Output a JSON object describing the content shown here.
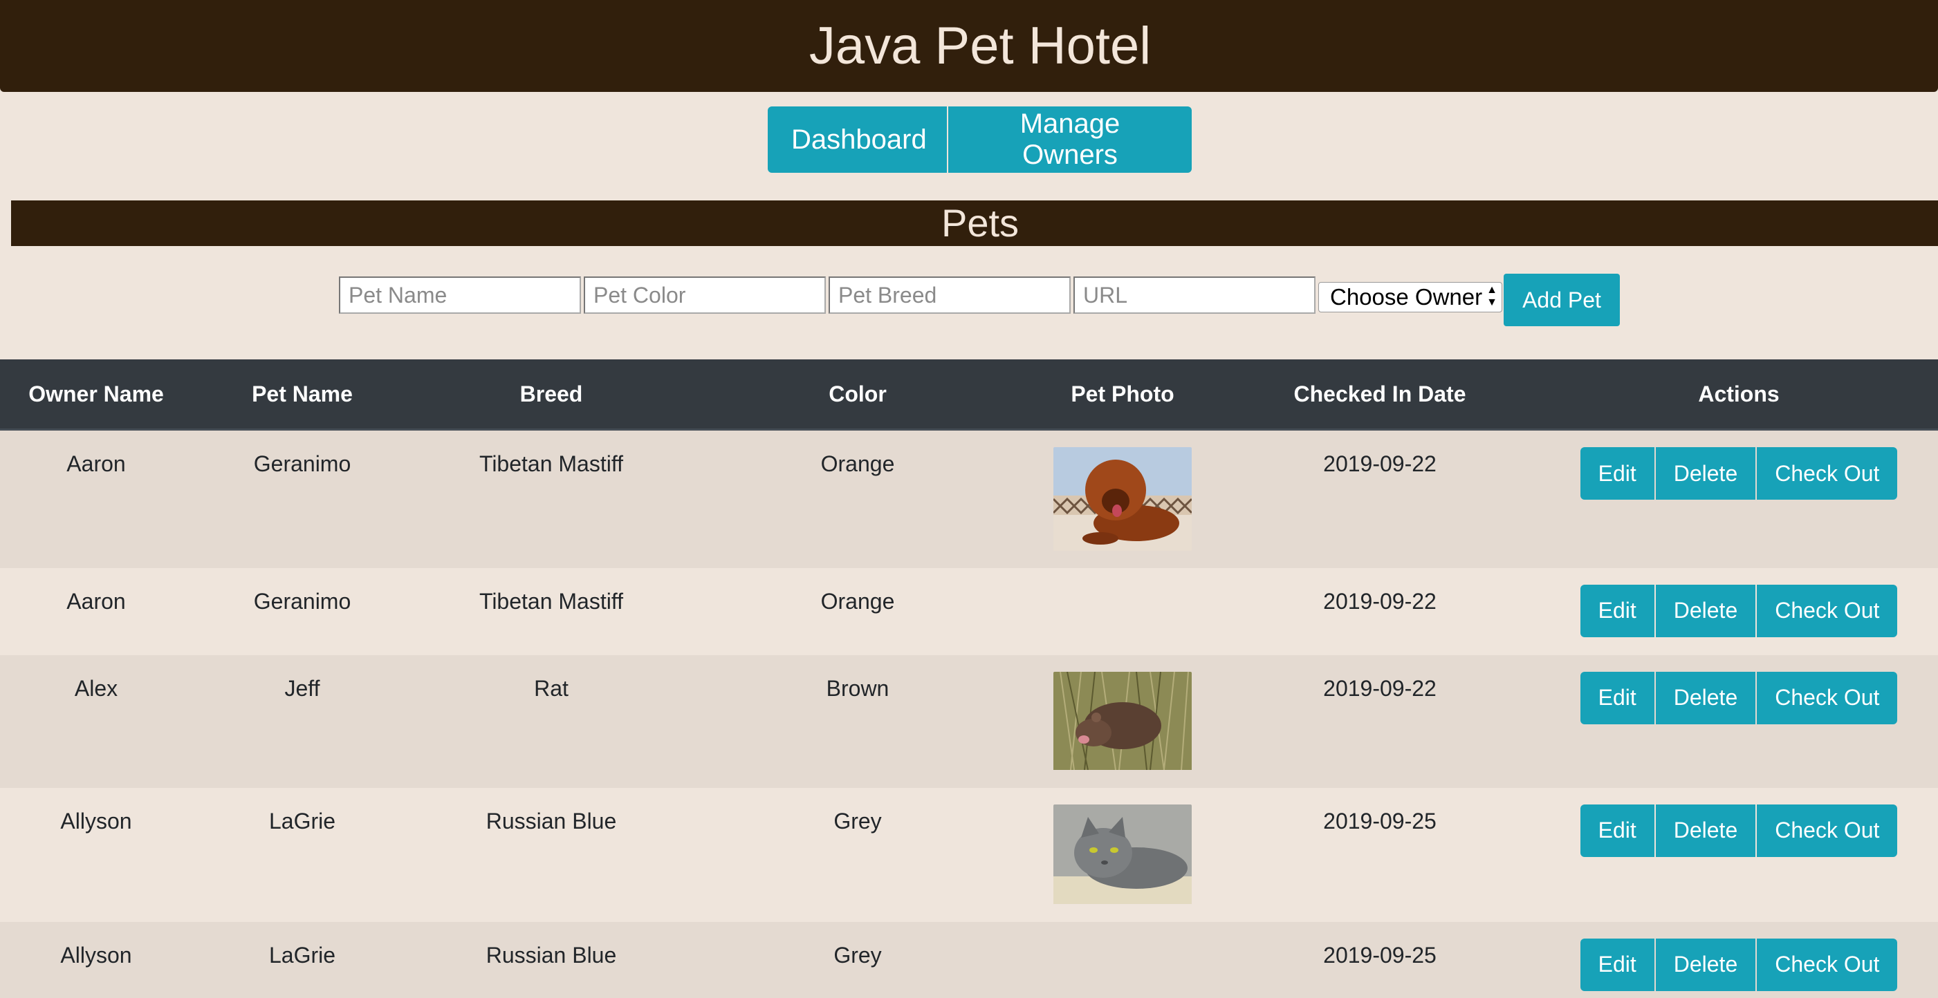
{
  "header": {
    "title": "Java Pet Hotel"
  },
  "nav": {
    "dashboard": "Dashboard",
    "manage_owners": "Manage Owners"
  },
  "section": {
    "title": "Pets"
  },
  "form": {
    "pet_name_placeholder": "Pet Name",
    "pet_color_placeholder": "Pet Color",
    "pet_breed_placeholder": "Pet Breed",
    "url_placeholder": "URL",
    "owner_select": "Choose Owner",
    "add_button": "Add Pet"
  },
  "table": {
    "columns": [
      "Owner Name",
      "Pet Name",
      "Breed",
      "Color",
      "Pet Photo",
      "Checked In Date",
      "Actions"
    ],
    "actions": {
      "edit": "Edit",
      "delete": "Delete",
      "check_out": "Check Out"
    },
    "rows": [
      {
        "owner": "Aaron",
        "pet": "Geranimo",
        "breed": "Tibetan Mastiff",
        "color": "Orange",
        "photo": "dog-photo",
        "date": "2019-09-22"
      },
      {
        "owner": "Aaron",
        "pet": "Geranimo",
        "breed": "Tibetan Mastiff",
        "color": "Orange",
        "photo": "",
        "date": "2019-09-22"
      },
      {
        "owner": "Alex",
        "pet": "Jeff",
        "breed": "Rat",
        "color": "Brown",
        "photo": "rat-photo",
        "date": "2019-09-22"
      },
      {
        "owner": "Allyson",
        "pet": "LaGrie",
        "breed": "Russian Blue",
        "color": "Grey",
        "photo": "cat-photo",
        "date": "2019-09-25"
      },
      {
        "owner": "Allyson",
        "pet": "LaGrie",
        "breed": "Russian Blue",
        "color": "Grey",
        "photo": "",
        "date": "2019-09-25"
      }
    ]
  },
  "colors": {
    "header_bg": "#311f0c",
    "page_bg": "#efe5dc",
    "accent": "#17a2b8",
    "table_header_bg": "#343a40"
  }
}
